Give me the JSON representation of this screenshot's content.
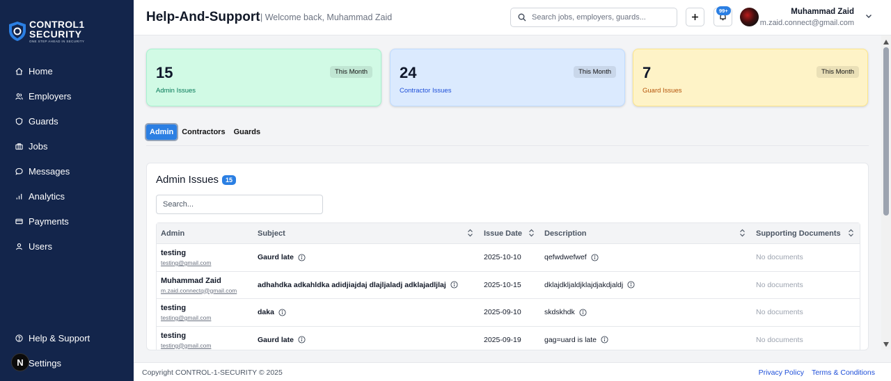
{
  "brand": {
    "line1": "CONTROL1",
    "line2": "SECURITY",
    "tagline": "ONE STEP AHEAD IN SECURITY"
  },
  "sidebar": {
    "items": [
      {
        "label": "Home",
        "icon": "home-icon"
      },
      {
        "label": "Employers",
        "icon": "users-icon"
      },
      {
        "label": "Guards",
        "icon": "shield-icon"
      },
      {
        "label": "Jobs",
        "icon": "briefcase-icon"
      },
      {
        "label": "Messages",
        "icon": "message-icon"
      },
      {
        "label": "Analytics",
        "icon": "bar-chart-icon"
      },
      {
        "label": "Payments",
        "icon": "credit-card-icon"
      },
      {
        "label": "Users",
        "icon": "user-icon"
      }
    ],
    "bottom": [
      {
        "label": "Help & Support",
        "icon": "help-circle-icon"
      },
      {
        "label": "Settings",
        "icon": "gear-icon"
      }
    ],
    "avatar_letter": "N"
  },
  "header": {
    "title": "Help-And-Support",
    "welcome": "| Welcome back, Muhammad Zaid",
    "search_placeholder": "Search jobs, employers, guards...",
    "notification_count": "99+",
    "user_name": "Muhammad Zaid",
    "user_email": "m.zaid.connect@gmail.com"
  },
  "stats": {
    "admin": {
      "value": "15",
      "label": "Admin Issues",
      "period": "This Month"
    },
    "contractor": {
      "value": "24",
      "label": "Contractor Issues",
      "period": "This Month"
    },
    "guard": {
      "value": "7",
      "label": "Guard Issues",
      "period": "This Month"
    }
  },
  "tabs": [
    "Admin",
    "Contractors",
    "Guards"
  ],
  "panel": {
    "title": "Admin Issues",
    "count": "15",
    "search_placeholder": "Search...",
    "columns": [
      "Admin",
      "Subject",
      "Issue Date",
      "Description",
      "Supporting Documents"
    ],
    "rows": [
      {
        "name": "testing",
        "email": "testing@gmail.com",
        "subject": "Gaurd late",
        "date": "2025-10-10",
        "description": "qefwdwefwef",
        "docs": "No documents"
      },
      {
        "name": "Muhammad Zaid",
        "email": "m.zaid.connectq@gmail.com",
        "subject": "adhahdka adkahldka adidjiajdaj dlajljaladj adklajadljlaj",
        "date": "2025-10-15",
        "description": "dklajdkljaldjklajdjakdjaldj",
        "docs": "No documents"
      },
      {
        "name": "testing",
        "email": "testing@gmail.com",
        "subject": "daka",
        "date": "2025-09-10",
        "description": "skdskhdk",
        "docs": "No documents"
      },
      {
        "name": "testing",
        "email": "testing@gmail.com",
        "subject": "Gaurd late",
        "date": "2025-09-19",
        "description": "gag=uard is late",
        "docs": "No documents"
      }
    ]
  },
  "footer": {
    "copyright": "Copyright CONTROL-1-SECURITY © 2025",
    "privacy": "Privacy Policy",
    "terms": "Terms & Conditions"
  },
  "colors": {
    "sidebar_bg": "#13254b",
    "accent": "#2b7fe3",
    "admin_card": "#d1fae5",
    "contractor_card": "#dbeafe",
    "guard_card": "#fef3c7"
  }
}
